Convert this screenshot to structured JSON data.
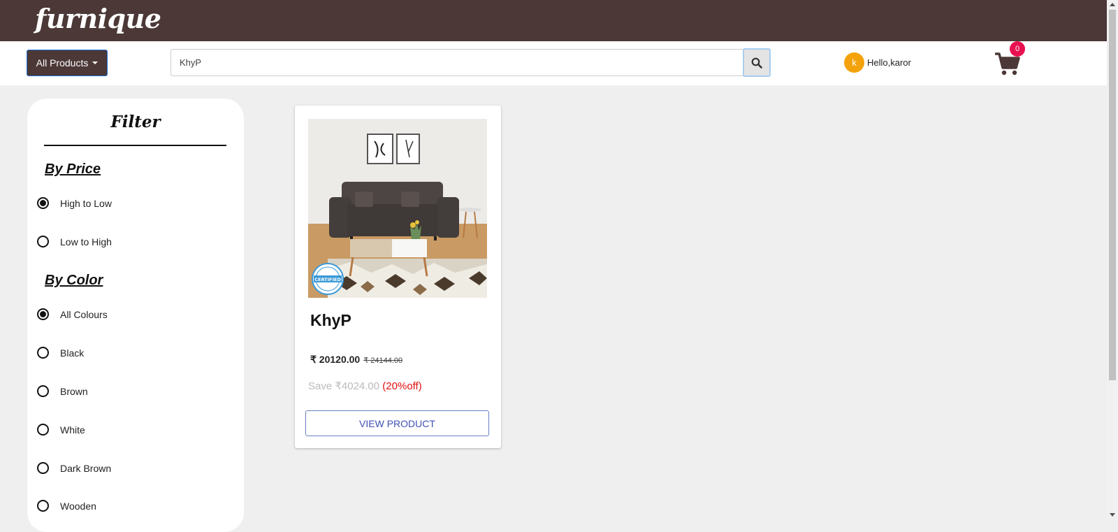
{
  "header": {
    "logo": "furnique",
    "all_products_label": "All Products",
    "search_value": "KhyP",
    "user_initial": "k",
    "greeting": "Hello,karor",
    "cart_count": "0"
  },
  "filter": {
    "title": "Filter",
    "price_heading": "By Price",
    "price_options": [
      {
        "label": "High to Low",
        "checked": true
      },
      {
        "label": "Low to High",
        "checked": false
      }
    ],
    "color_heading": "By Color",
    "color_options": [
      {
        "label": "All Colours",
        "checked": true
      },
      {
        "label": "Black",
        "checked": false
      },
      {
        "label": "Brown",
        "checked": false
      },
      {
        "label": "White",
        "checked": false
      },
      {
        "label": "Dark Brown",
        "checked": false
      },
      {
        "label": "Wooden",
        "checked": false
      }
    ]
  },
  "products": [
    {
      "name": "KhyP",
      "price": "₹ 20120.00",
      "mrp": "₹ 24144.00",
      "save": "Save ₹4024.00",
      "discount": "(20%off)",
      "button": "VIEW PRODUCT",
      "badge_text": "CERTIFIED"
    }
  ],
  "colors": {
    "brand": "#4b3837",
    "avatar": "#f4a20c",
    "badge": "#e8104f",
    "discount": "#e01010",
    "button_text": "#3f51b5"
  }
}
